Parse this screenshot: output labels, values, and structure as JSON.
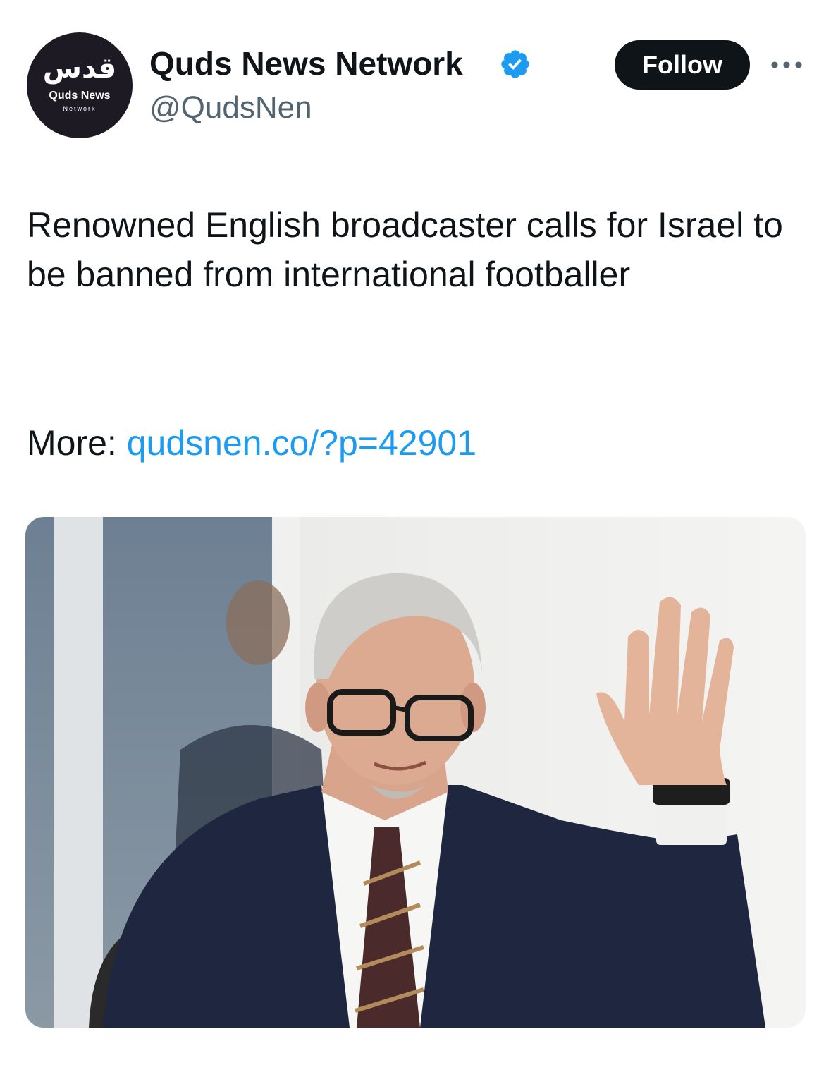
{
  "account": {
    "avatar_arabic": "قدس",
    "avatar_name": "Quds News",
    "avatar_sub": "Network",
    "display_name": "Quds News Network",
    "handle": "@QudsNen",
    "verified_icon": "verified-badge-icon",
    "verified_color": "#1d9bf0"
  },
  "actions": {
    "follow_label": "Follow",
    "more_icon": "more-horizontal-icon"
  },
  "tweet": {
    "text": "Renowned English broadcaster calls for Israel to be banned from international footballer",
    "more_label": "More:",
    "link_text": "qudsnen.co/?p=42901",
    "link_color": "#1d9bf0"
  },
  "media": {
    "type": "photo"
  }
}
